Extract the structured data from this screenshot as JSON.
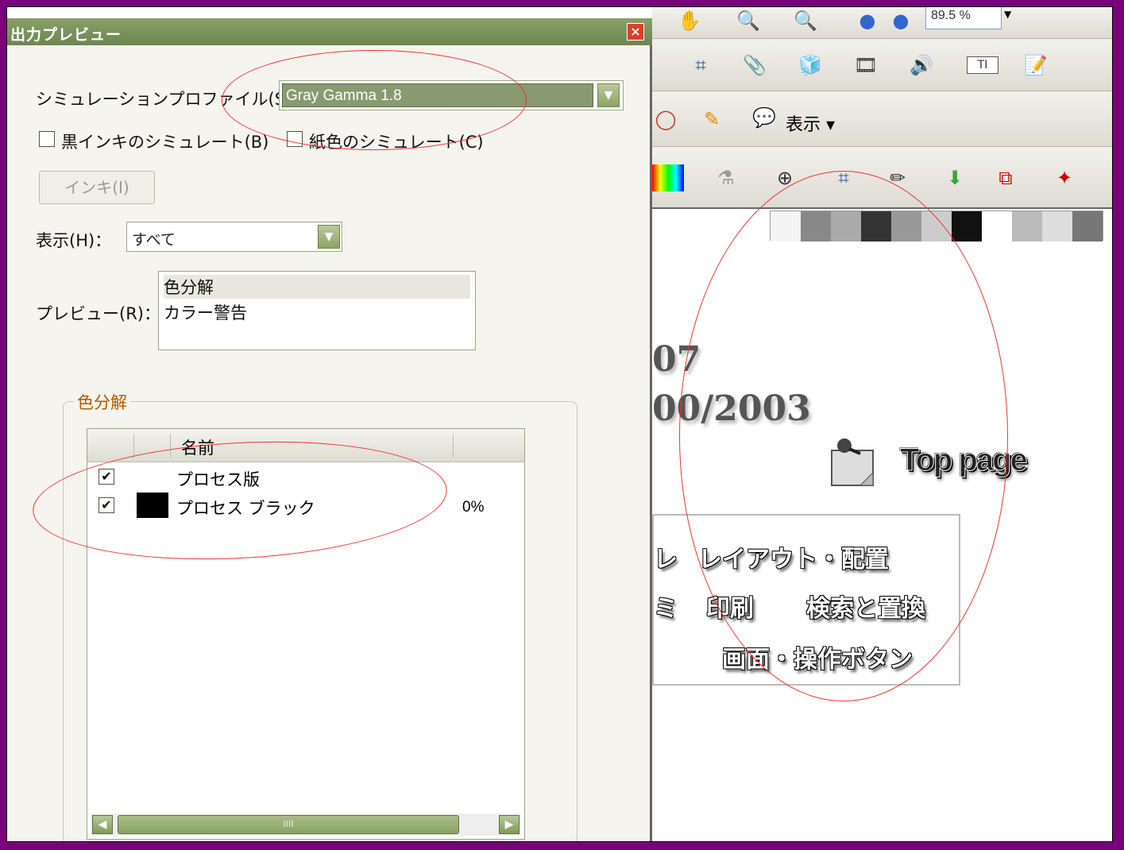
{
  "dialog": {
    "title": "出力プレビュー",
    "close_label": "×",
    "profile_label": "シミュレーションプロファイル(S)：",
    "profile_value": "Gray Gamma 1.8",
    "black_ink_label": "黒インキのシミュレート(B)",
    "paper_color_label": "紙色のシミュレート(C)",
    "ink_button": "インキ(I)",
    "show_label": "表示(H)：",
    "show_value": "すべて",
    "preview_label": "プレビュー(R)：",
    "preview_items": [
      "色分解",
      "カラー警告"
    ],
    "separations_group": "色分解",
    "table_header_name": "名前",
    "rows": [
      {
        "name": "プロセス版",
        "checked": true,
        "swatch": "",
        "percent": ""
      },
      {
        "name": "プロセス ブラック",
        "checked": true,
        "swatch": "#000000",
        "percent": "0%"
      }
    ],
    "scroll_grip": "IIII"
  },
  "app": {
    "zoom_value": "89.5 %",
    "show_menu_label": "表示",
    "year1": "07",
    "year2": "00/2003",
    "top_page": "Top page",
    "menu": {
      "layout": "レイアウト・配置",
      "print": "印刷",
      "search_replace": "検索と置換",
      "screen_buttons": "画面・操作ボタン",
      "partial1": "レ",
      "partial2": "ミ"
    },
    "swatch_colors": [
      "#f4f4f4",
      "#888888",
      "#aaaaaa",
      "#333333",
      "#999999",
      "#cccccc",
      "#111111",
      "#ffffff",
      "#bbbbbb",
      "#dddddd",
      "#777777"
    ]
  },
  "colors": {
    "accent_green": "#8aa266",
    "annotation_red": "#ee3333",
    "frame": "#7a007a"
  }
}
